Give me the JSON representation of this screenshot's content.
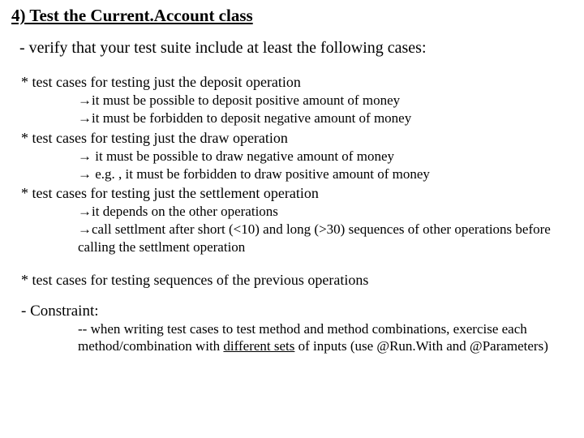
{
  "title": "4) Test the Current.Account class",
  "intro": "- verify that your test suite include at least the following cases:",
  "sections": {
    "deposit": {
      "bullet": "* test cases for testing just the deposit operation",
      "sub1": "→it must be possible to deposit positive amount of money",
      "sub2": "→it must be forbidden to deposit negative amount of money"
    },
    "draw": {
      "bullet": "* test cases for testing just the draw operation",
      "sub1": "→ it must be possible to draw negative amount of money",
      "sub2": "→ e.g. , it must be forbidden to draw positive amount of money"
    },
    "settlement": {
      "bullet": "* test cases for testing just the settlement operation",
      "sub1": "→it depends on the other operations",
      "sub2": "→call settlment after short (<10) and long (>30) sequences of other operations before calling the settlment operation"
    },
    "sequences": {
      "bullet": "* test cases for testing sequences of the previous operations"
    }
  },
  "constraint": {
    "label": "- Constraint:",
    "sub_pre": "-- when writing test cases to test method and method combinations, exercise each method/combination with ",
    "underlined": "different sets",
    "sub_post": " of inputs (use @Run.With and @Parameters)"
  }
}
